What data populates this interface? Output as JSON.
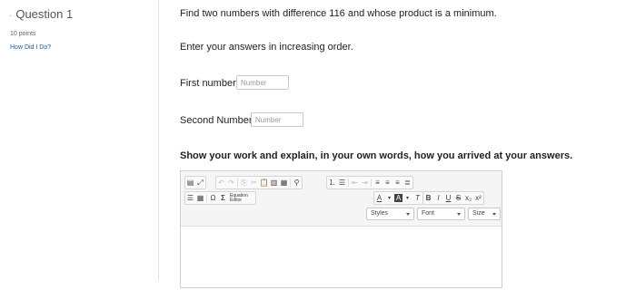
{
  "sidebar": {
    "question_title": "Question 1",
    "points": "10 points",
    "how_did_i_do": "How Did I Do?"
  },
  "prompt": {
    "line1": "Find two numbers with difference 116 and whose product is a minimum.",
    "line2": "Enter your answers in increasing order.",
    "first_label": "First number:",
    "first_placeholder": "Number",
    "second_label": "Second Number:",
    "second_placeholder": "Number",
    "explain": "Show your work and explain, in your own words, how you arrived at your answers."
  },
  "editor": {
    "equation_editor_label": "Equation Editor",
    "styles": "Styles",
    "font": "Font",
    "size": "Size"
  }
}
